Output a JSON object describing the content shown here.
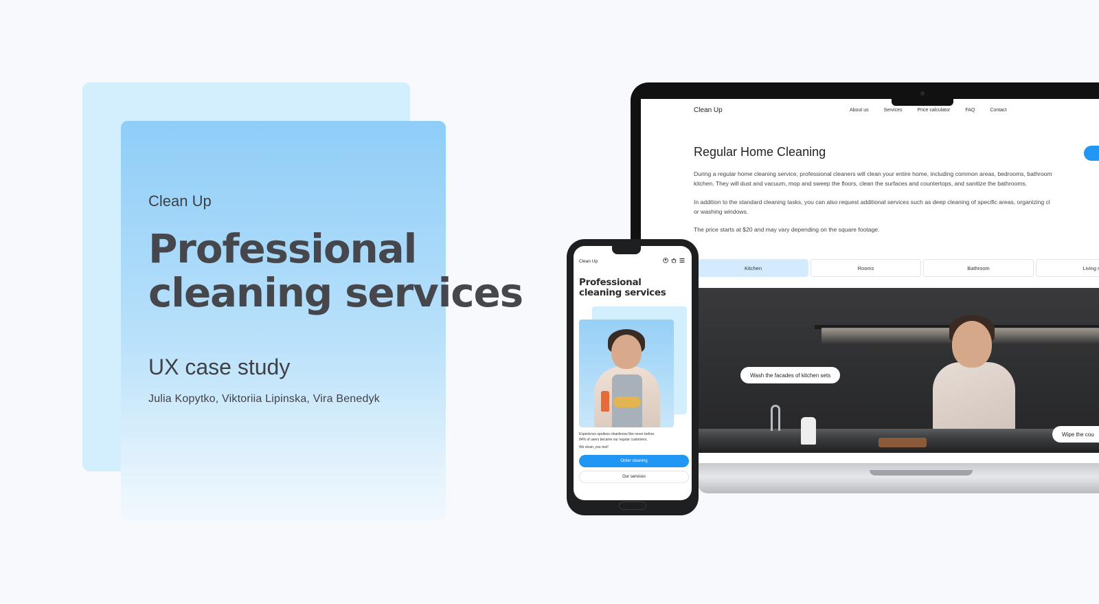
{
  "hero": {
    "brand": "Clean Up",
    "title_line1": "Professional",
    "title_line2": "cleaning services",
    "subtitle": "UX case study",
    "authors": "Julia Kopytko, Viktoriia Lipinska, Vira Benedyk"
  },
  "desktop": {
    "brand": "Clean Up",
    "nav": [
      "About us",
      "Services",
      "Price calculator",
      "FAQ",
      "Contact"
    ],
    "heading": "Regular Home Cleaning",
    "paragraphs": [
      "During a regular home cleaning service, professional cleaners will clean your entire home, including common areas, bedrooms, bathroom",
      "kitchen. They will dust and vacuum, mop and sweep the floors, clean the surfaces and countertops, and sanitize the bathrooms.",
      "In addition to the standard cleaning tasks, you can also request additional services such as deep cleaning of specific areas, organizing cl",
      "or washing windows.",
      "The price starts at $20 and may vary depending on the square footage."
    ],
    "tabs": [
      "Kitchen",
      "Rooms",
      "Bathroom",
      "Living r"
    ],
    "active_tab": "Kitchen",
    "tooltips": [
      "Wash the facades of kitchen sets",
      "Wipe the cou"
    ]
  },
  "mobile": {
    "brand": "Clean Up",
    "icons": [
      "user-icon",
      "basket-icon",
      "menu-icon"
    ],
    "title_line1": "Professional",
    "title_line2": "cleaning services",
    "text_line1": "Experience spotless cleanliness like never before.",
    "text_line2": "84% of users became our regular customers.",
    "text_line3": "We clean, you rest!",
    "primary_button": "Order cleaning",
    "secondary_button": "Our services"
  },
  "colors": {
    "accent": "#2196f3",
    "active_tab": "#d3ebfc",
    "card_back": "#d3eefc",
    "card_front": "#8fcdf8"
  }
}
